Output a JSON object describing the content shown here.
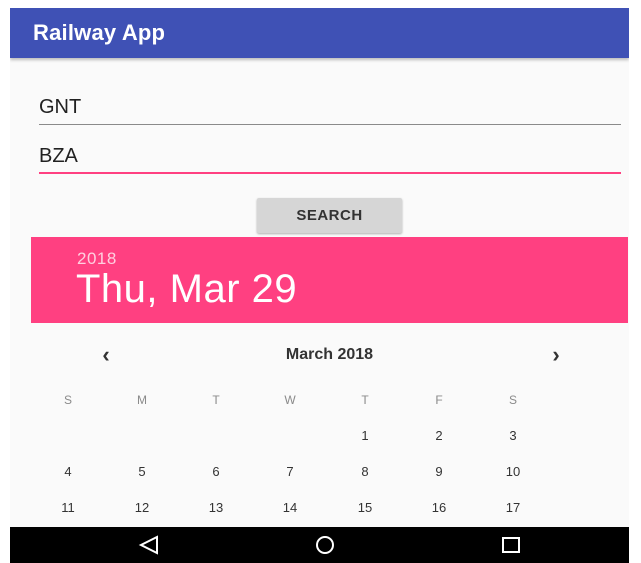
{
  "app": {
    "title": "Railway App"
  },
  "form": {
    "from_value": "GNT",
    "to_value": "BZA",
    "search_label": "SEARCH"
  },
  "date_picker": {
    "year": "2018",
    "selected_date": "Thu, Mar 29",
    "month_title": "March 2018",
    "prev_icon": "chevron-left-icon",
    "next_icon": "chevron-right-icon",
    "weekdays": [
      "S",
      "M",
      "T",
      "W",
      "T",
      "F",
      "S"
    ],
    "weeks": [
      [
        "",
        "",
        "",
        "",
        "1",
        "2",
        "3"
      ],
      [
        "4",
        "5",
        "6",
        "7",
        "8",
        "9",
        "10"
      ],
      [
        "11",
        "12",
        "13",
        "14",
        "15",
        "16",
        "17"
      ]
    ]
  },
  "colors": {
    "primary": "#3f51b5",
    "accent": "#ff4081",
    "nav_bar": "#000000"
  },
  "system_nav": {
    "back_icon": "back-triangle-icon",
    "home_icon": "home-circle-icon",
    "recents_icon": "recents-square-icon"
  }
}
